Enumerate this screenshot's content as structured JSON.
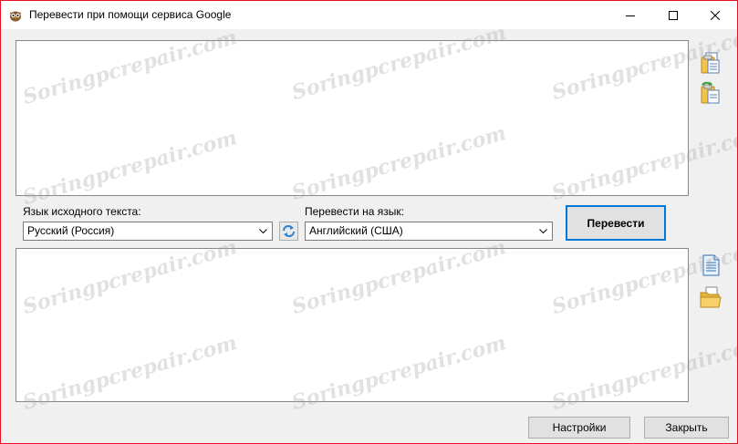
{
  "window": {
    "title": "Перевести при помощи сервиса Google",
    "controls": [
      "minimize",
      "maximize",
      "close"
    ]
  },
  "source": {
    "language_label": "Язык исходного текста:",
    "language_value": "Русский (Россия)",
    "text": ""
  },
  "target": {
    "language_label": "Перевести на язык:",
    "language_value": "Английский (США)",
    "text": ""
  },
  "buttons": {
    "translate": "Перевести",
    "settings": "Настройки",
    "close": "Закрыть"
  },
  "icons": {
    "app": "owl-icon",
    "source_side": [
      "copy-icon",
      "paste-icon"
    ],
    "swap": "swap-icon",
    "target_side": [
      "document-icon",
      "open-folder-icon"
    ]
  },
  "watermark": "Soringpcrepair.com",
  "colors": {
    "accent": "#0078d7",
    "window_border": "#e81123",
    "background": "#f0f0f0"
  }
}
